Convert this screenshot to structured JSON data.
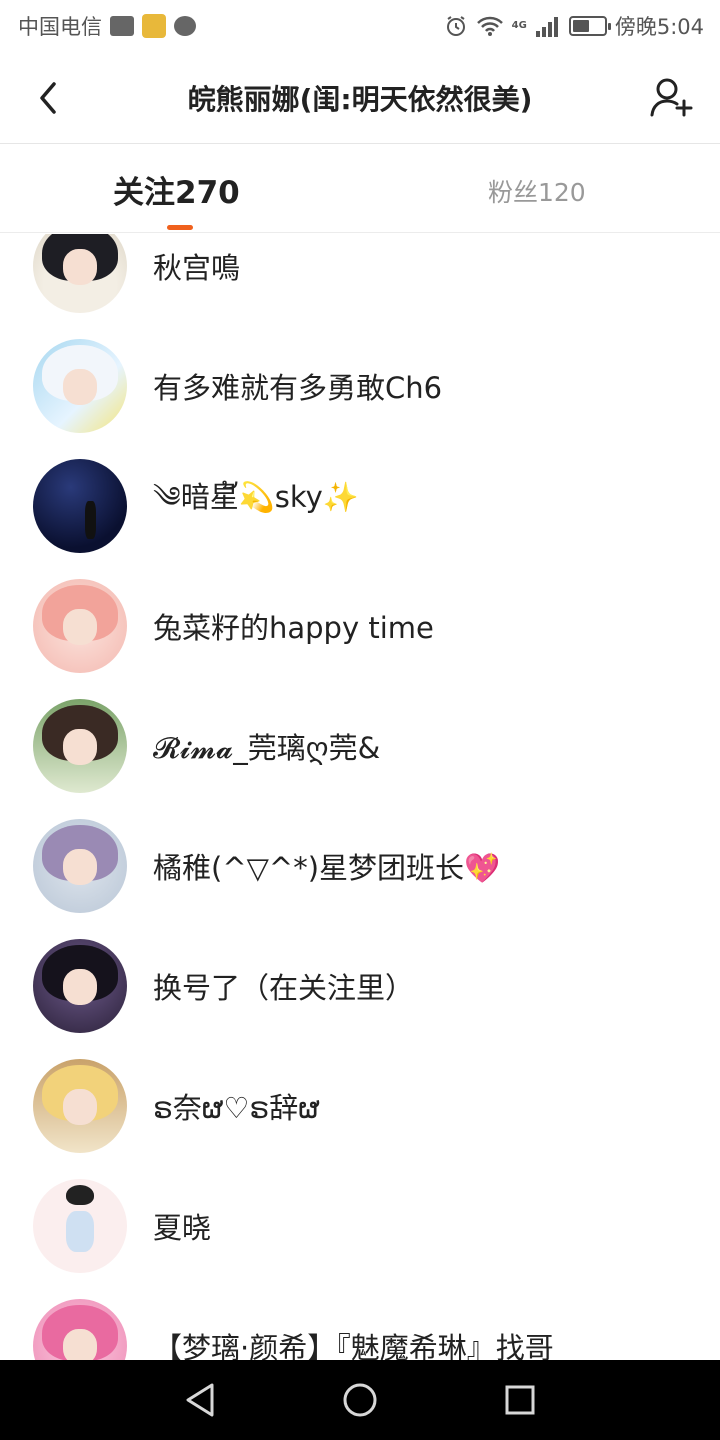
{
  "status_bar": {
    "carrier": "中国电信",
    "network": "4G",
    "time": "傍晚5:04",
    "battery_level": 0.55,
    "icons": [
      "pulse-icon",
      "badge-icon",
      "chat-icon",
      "alarm-icon",
      "wifi-icon",
      "signal-icon",
      "battery-icon"
    ]
  },
  "header": {
    "title": "皖熊丽娜(闺:明天依然很美)",
    "back_icon": "chevron-left-icon",
    "action_icon": "add-user-icon"
  },
  "tabs": {
    "following_label": "关注270",
    "fans_label": "粉丝120",
    "accent": "#f0611d",
    "active": "following"
  },
  "following_list": [
    {
      "name": "秋宫鳴",
      "avatar": "avatar-icon"
    },
    {
      "name": "有多难就有多勇敢Ch6",
      "avatar": "avatar-icon"
    },
    {
      "name": "༄暗星້💫sky✨",
      "avatar": "avatar-icon"
    },
    {
      "name": "兔菜籽的happy time",
      "avatar": "avatar-icon"
    },
    {
      "name": "𝓡𝓲𝓶𝓪_莞璃ღ莞&",
      "avatar": "avatar-icon"
    },
    {
      "name": "橘稚(^▽^*)星梦团班长💖",
      "avatar": "avatar-icon"
    },
    {
      "name": "换号了（在关注里）",
      "avatar": "avatar-icon"
    },
    {
      "name": "ຣ奈ຜ♡ຣ辞ຜ",
      "avatar": "avatar-icon"
    },
    {
      "name": "夏晓",
      "avatar": "avatar-icon"
    },
    {
      "name": "【梦璃·颜希】『魅魔希琳』找哥",
      "avatar": "avatar-icon"
    }
  ],
  "nav_bar": {
    "icons": [
      "nav-back-icon",
      "nav-home-icon",
      "nav-recents-icon"
    ]
  }
}
